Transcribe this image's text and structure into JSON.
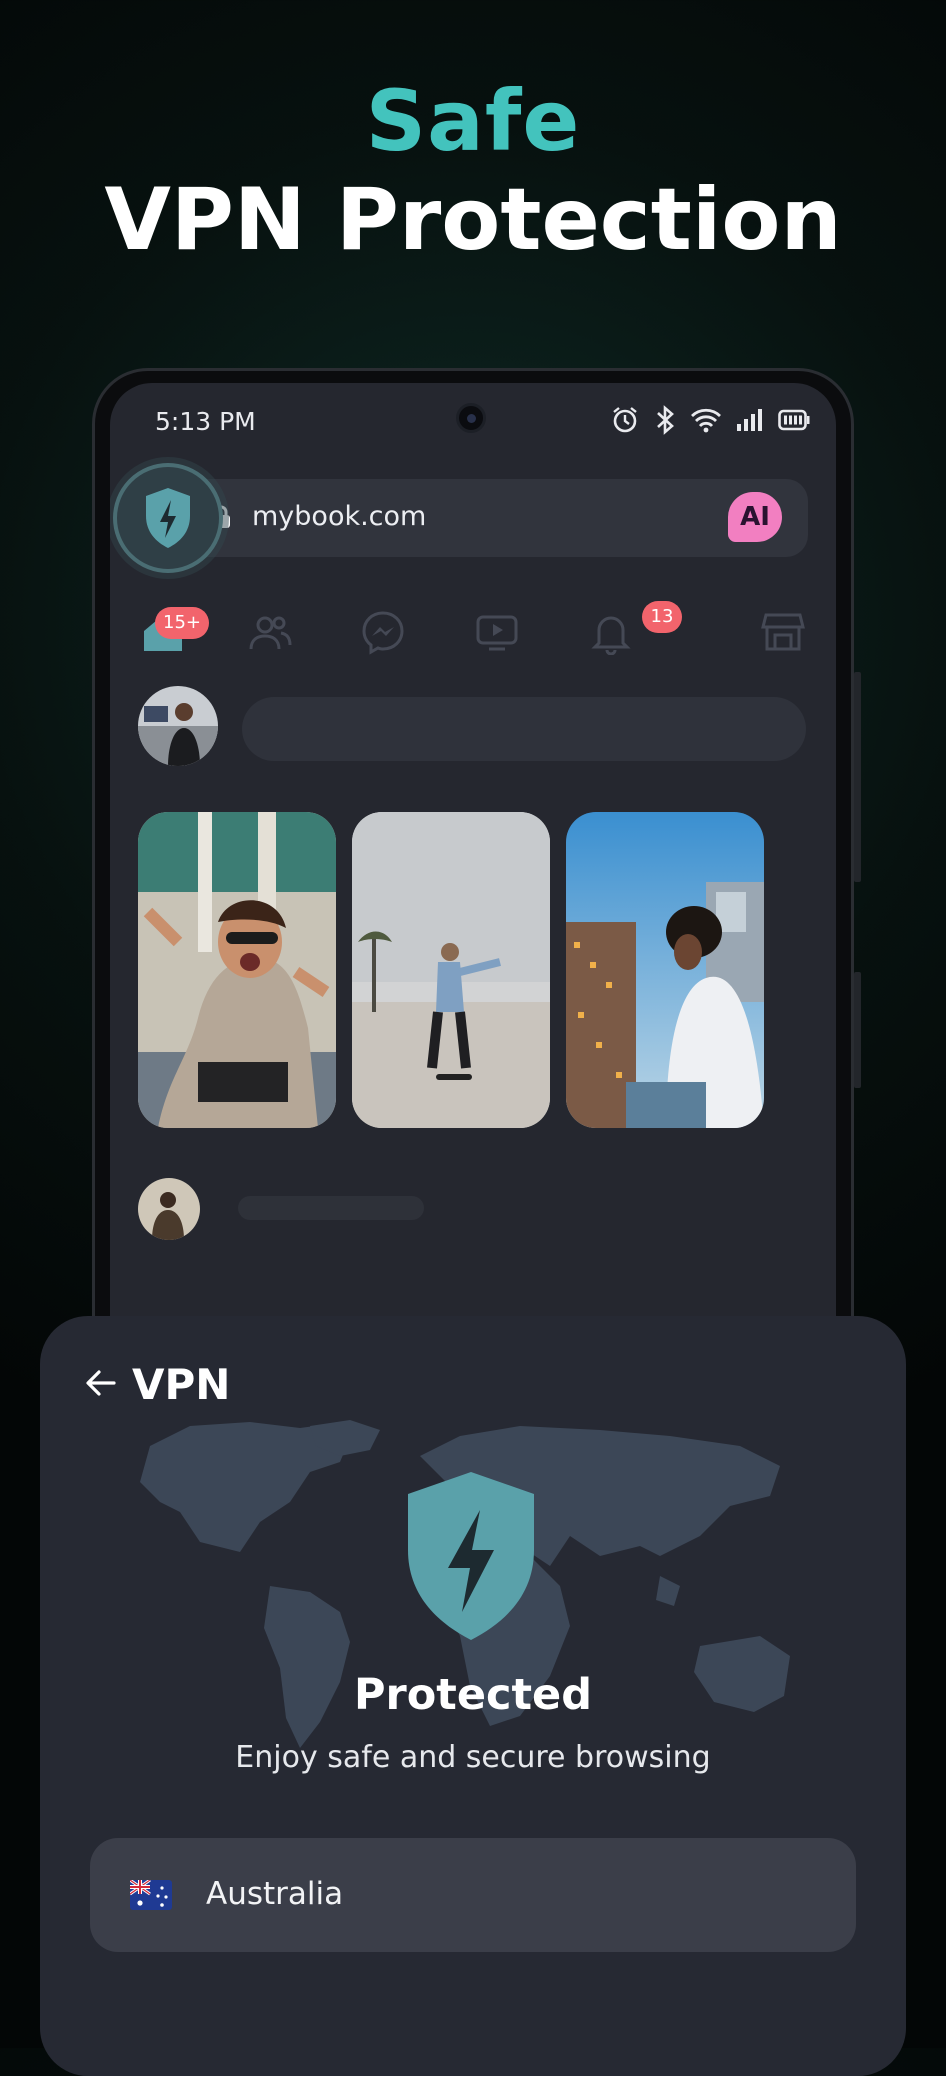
{
  "headline": {
    "accent": "Safe",
    "main": "VPN Protection"
  },
  "status_bar": {
    "time": "5:13 PM"
  },
  "browser": {
    "url": "mybook.com",
    "ai_label": "AI"
  },
  "nav": {
    "home_badge": "15+",
    "notifications_badge": "13"
  },
  "vpn_panel": {
    "title": "VPN",
    "status": "Protected",
    "subtitle": "Enjoy safe and secure browsing",
    "country": "Australia"
  },
  "colors": {
    "accent": "#43c3bd",
    "shield": "#5aa1aa",
    "badge": "#f2646c",
    "ai_badge": "#f27fc1",
    "sheet_bg": "#262933"
  },
  "icons": [
    "vpn-shield-icon",
    "lock-icon",
    "home-icon",
    "friends-icon",
    "messenger-icon",
    "video-icon",
    "bell-icon",
    "marketplace-icon",
    "arrow-left-icon",
    "australia-flag-icon",
    "alarm-icon",
    "bluetooth-icon",
    "wifi-icon",
    "signal-icon",
    "battery-icon"
  ]
}
